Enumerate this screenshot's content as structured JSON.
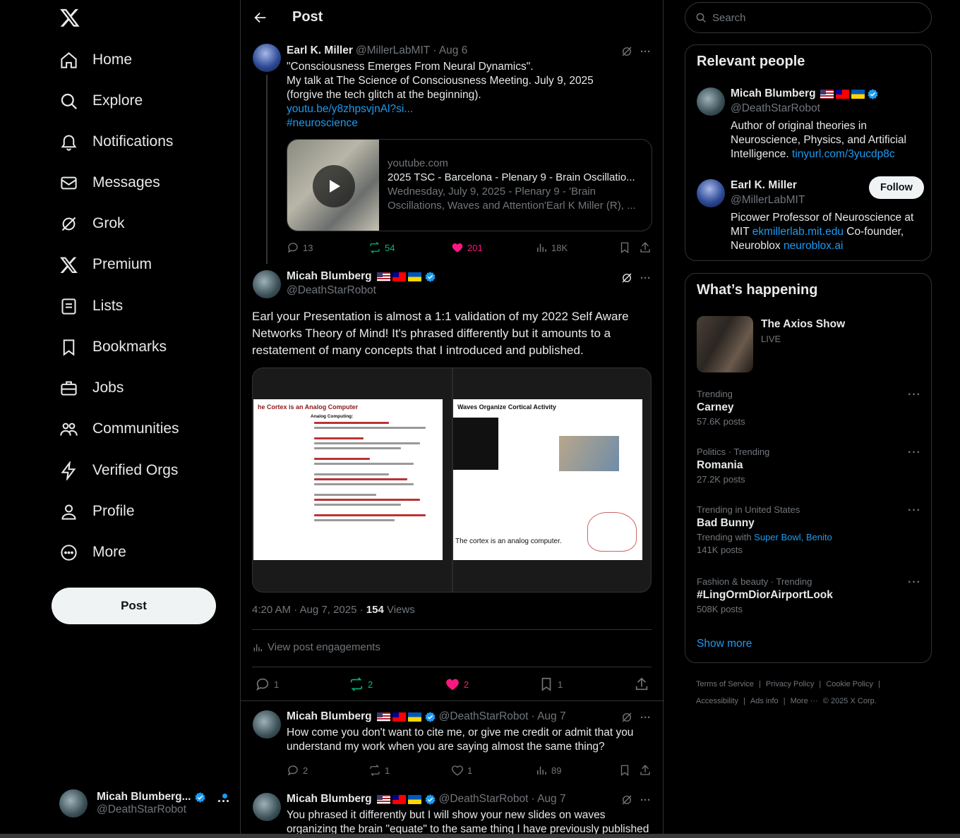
{
  "nav": {
    "items": [
      {
        "label": "Home",
        "icon": "home-icon"
      },
      {
        "label": "Explore",
        "icon": "search-icon"
      },
      {
        "label": "Notifications",
        "icon": "bell-icon"
      },
      {
        "label": "Messages",
        "icon": "envelope-icon"
      },
      {
        "label": "Grok",
        "icon": "grok-icon"
      },
      {
        "label": "Premium",
        "icon": "x-logo-icon"
      },
      {
        "label": "Lists",
        "icon": "list-icon"
      },
      {
        "label": "Bookmarks",
        "icon": "bookmark-icon"
      },
      {
        "label": "Jobs",
        "icon": "briefcase-icon"
      },
      {
        "label": "Communities",
        "icon": "people-icon"
      },
      {
        "label": "Verified Orgs",
        "icon": "lightning-icon"
      },
      {
        "label": "Profile",
        "icon": "person-icon"
      },
      {
        "label": "More",
        "icon": "more-circle-icon"
      }
    ],
    "post_button": "Post",
    "account": {
      "name": "Micah Blumberg...",
      "handle": "@DeathStarRobot"
    }
  },
  "header": {
    "title": "Post"
  },
  "parent_tweet": {
    "author": "Earl K. Miller",
    "handle": "@MillerLabMIT",
    "date": "· Aug 6",
    "line1": "\"Consciousness Emerges From Neural Dynamics\".",
    "line2": "My talk at The Science of Consciousness Meeting. July 9, 2025",
    "line3": "(forgive the tech glitch at the beginning).",
    "link": "youtu.be/y8zhpsvjnAl?si...",
    "hashtag": "#neuroscience",
    "card": {
      "domain": "youtube.com",
      "title": "2025 TSC - Barcelona - Plenary 9 - Brain Oscillatio...",
      "desc1": "Wednesday, July 9, 2025 - Plenary 9 - 'Brain",
      "desc2": "Oscillations, Waves and Attention'Earl K Miller (R), ..."
    },
    "replies": "13",
    "reposts": "54",
    "likes": "201",
    "views": "18K"
  },
  "main_tweet": {
    "author": "Micah Blumberg",
    "handle": "@DeathStarRobot",
    "text": "Earl your Presentation is almost a 1:1 validation of my 2022 Self Aware Networks  Theory of Mind! It's phrased differently but it amounts to a restatement of many concepts that I introduced and published.",
    "slide_left_title": "he Cortex is an Analog Computer",
    "slide_left_sub": "Analog Computing:",
    "slide_right_title": "Waves Organize Cortical Activity",
    "slide_right_bottom": "The cortex is an analog computer.",
    "time": "4:20 AM · Aug 7, 2025 · ",
    "views_count": "154",
    "views_label": " Views",
    "engagements": "View post engagements",
    "replies": "1",
    "reposts": "2",
    "likes": "2",
    "bookmarks": "1"
  },
  "replies": [
    {
      "author": "Micah Blumberg",
      "handle": "@DeathStarRobot",
      "date": "· Aug 7",
      "text": "How come you don't want to cite me, or give me credit or admit that you understand my work when you are saying almost the same thing?",
      "replies": "2",
      "reposts": "1",
      "likes": "1",
      "views": "89"
    },
    {
      "author": "Micah Blumberg",
      "handle": "@DeathStarRobot",
      "date": "· Aug 7",
      "text": "You phrased it differently but I will show your new slides on waves organizing the brain \"equate\" to the same thing I have previously published"
    }
  ],
  "search": {
    "placeholder": "Search"
  },
  "relevant": {
    "title": "Relevant people",
    "people": [
      {
        "name": "Micah Blumberg",
        "handle": "@DeathStarRobot",
        "bio": "Author of original theories in Neuroscience, Physics, and Artificial Intelligence. ",
        "link": "tinyurl.com/3yucdp8c"
      },
      {
        "name": "Earl K. Miller",
        "handle": "@MillerLabMIT",
        "follow": "Follow",
        "bio_a": "Picower Professor of Neuroscience at MIT ",
        "link_a": "ekmillerlab.mit.edu",
        "bio_b": " Co-founder, Neuroblox ",
        "link_b": "neuroblox.ai"
      }
    ]
  },
  "happening": {
    "title": "What’s happening",
    "live": {
      "name": "The Axios Show",
      "status": "LIVE"
    },
    "trends": [
      {
        "category": "Trending",
        "name": "Carney",
        "posts": "57.6K posts"
      },
      {
        "category": "Politics · Trending",
        "name": "Romania",
        "posts": "27.2K posts"
      },
      {
        "category": "Trending in United States",
        "name": "Bad Bunny",
        "extra_label": "Trending with ",
        "extra_links": "Super Bowl, Benito",
        "posts": "141K posts"
      },
      {
        "category": "Fashion & beauty · Trending",
        "name": "#LingOrmDiorAirportLook",
        "posts": "508K posts"
      }
    ],
    "show_more": "Show more"
  },
  "footer": {
    "links": [
      "Terms of Service",
      "Privacy Policy",
      "Cookie Policy",
      "Accessibility",
      "Ads info",
      "More ···"
    ],
    "copyright": "© 2025 X Corp."
  },
  "colors": {
    "accent": "#1d9bf0",
    "like": "#f91880",
    "repost": "#00ba7c",
    "background": "#000000"
  }
}
